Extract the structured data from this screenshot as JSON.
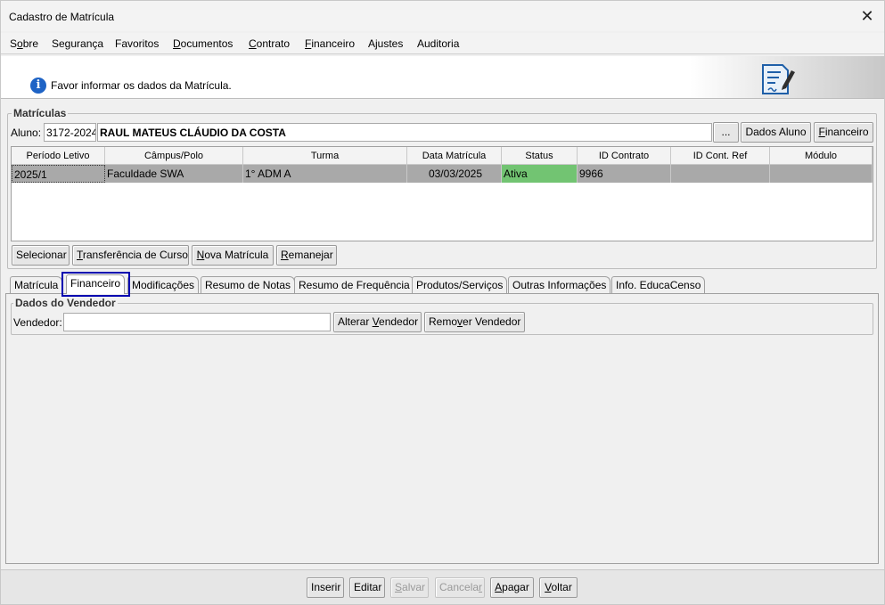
{
  "window": {
    "title": "Cadastro de Matrícula",
    "close_glyph": "✕"
  },
  "menu": [
    {
      "label": "Sobre",
      "pre": "S",
      "ul": "o",
      "post": "bre"
    },
    {
      "label": "Segurança"
    },
    {
      "label": "Favoritos"
    },
    {
      "label": "Documentos",
      "pre": "",
      "ul": "D",
      "post": "ocumentos"
    },
    {
      "label": "Contrato",
      "pre": "",
      "ul": "C",
      "post": "ontrato"
    },
    {
      "label": "Financeiro",
      "pre": "",
      "ul": "F",
      "post": "inanceiro"
    },
    {
      "label": "Ajustes"
    },
    {
      "label": "Auditoria"
    }
  ],
  "header": {
    "message": "Favor informar os dados da Matrícula.",
    "info_icon": "info-icon",
    "doc_icon": "document-edit-icon"
  },
  "matriculas": {
    "group_label": "Matrículas",
    "aluno_label": "Aluno:",
    "aluno_code": "3172-2024",
    "aluno_name": "RAUL MATEUS CLÁUDIO DA COSTA",
    "browse_label": "...",
    "dados_aluno_label": "Dados Aluno",
    "financeiro_label": "Financeiro",
    "columns": [
      "Período Letivo",
      "Câmpus/Polo",
      "Turma",
      "Data Matrícula",
      "Status",
      "ID Contrato",
      "ID Cont. Ref",
      "Módulo"
    ],
    "rows": [
      {
        "periodo": "2025/1",
        "campus": "Faculdade SWA",
        "turma": "1° ADM A",
        "data": "03/03/2025",
        "status": "Ativa",
        "id_contrato": "9966",
        "id_cont_ref": "",
        "modulo": ""
      }
    ],
    "status_color": "#72c472",
    "buttons": {
      "selecionar": "Selecionar",
      "transferencia": "Transferência de Curso",
      "nova_matricula": "Nova Matrícula",
      "remanejar": "Remanejar"
    }
  },
  "tabs": [
    "Matrícula",
    "Financeiro",
    "Modificações",
    "Resumo de Notas",
    "Resumo de Frequência",
    "Produtos/Serviços",
    "Outras Informações",
    "Info. EducaCenso"
  ],
  "active_tab": "Financeiro",
  "vendedor": {
    "group_label": "Dados do Vendedor",
    "label": "Vendedor:",
    "value": "",
    "alterar_label": "Alterar Vendedor",
    "remover_label": "Remover Vendedor"
  },
  "footer": {
    "inserir": "Inserir",
    "editar": "Editar",
    "salvar": "Salvar",
    "cancelar": "Cancelar",
    "apagar": "Apagar",
    "voltar": "Voltar"
  },
  "colors": {
    "highlight_border": "#0000b0",
    "selected_row": "#a9a9a9"
  }
}
